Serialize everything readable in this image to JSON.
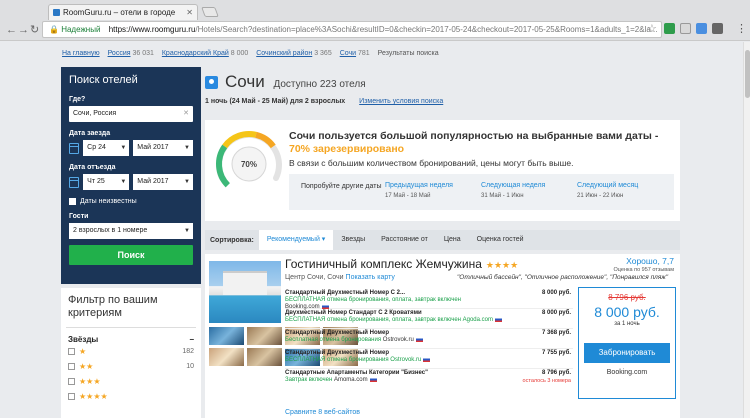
{
  "browser": {
    "tab_title": "RoomGuru.ru – отели в городе",
    "secure_label": "Надежный",
    "url_host": "https://www.roomguru.ru",
    "url_path": "/Hotels/Search?destination=place%3ASochi&resultID=0&checkin=2017-05-24&checkout=2017-05-25&Rooms=1&adults_1=2&la..."
  },
  "breadcrumbs": [
    {
      "label": "На главную",
      "count": ""
    },
    {
      "label": "Россия",
      "count": "36 031"
    },
    {
      "label": "Краснодарский Край",
      "count": "8 000"
    },
    {
      "label": "Сочинский район",
      "count": "3 365"
    },
    {
      "label": "Сочи",
      "count": "781"
    },
    {
      "label": "Результаты поиска",
      "count": ""
    }
  ],
  "search": {
    "title": "Поиск отелей",
    "where_label": "Где?",
    "where_value": "Сочи, Россия",
    "checkin_label": "Дата заезда",
    "checkin_day": "Ср 24",
    "checkin_month": "Май 2017",
    "checkout_label": "Дата отъезда",
    "checkout_day": "Чт 25",
    "checkout_month": "Май 2017",
    "unknown_dates": "Даты неизвестны",
    "guests_label": "Гости",
    "guests_value": "2 взрослых в 1 номере",
    "button": "Поиск"
  },
  "filter": {
    "title": "Фильтр по вашим критериям",
    "stars_label": "Звёзды",
    "rows": [
      {
        "stars": "★",
        "count": "182"
      },
      {
        "stars": "★★",
        "count": "10"
      },
      {
        "stars": "★★★",
        "count": ""
      },
      {
        "stars": "★★★★",
        "count": ""
      }
    ]
  },
  "header": {
    "city": "Сочи",
    "available": "Доступно 223 отеля",
    "nights": "1 ночь (24 Май - 25 Май) для 2 взрослых",
    "change_link": "Изменить условия поиска"
  },
  "popularity": {
    "gauge_percent": 70,
    "gauge_label": "70%",
    "main_text": "Сочи пользуется большой популярностью на выбранные вами даты -",
    "highlight": "70% зарезервировано",
    "note": "В связи с большим количеством бронирований, цены могут быть выше.",
    "alt_label": "Попробуйте другие даты",
    "alternatives": [
      {
        "link": "Предыдущая неделя",
        "dates": "17 Май - 18 Май"
      },
      {
        "link": "Следующая неделя",
        "dates": "31 Май - 1 Июн"
      },
      {
        "link": "Следующий месяц",
        "dates": "21 Июн - 22 Июн"
      }
    ],
    "colors": {
      "green": "#3cb878",
      "yellow": "#f5c518",
      "orange": "#f5a623",
      "grey": "#e3e3e3"
    }
  },
  "sort": {
    "label": "Сортировка:",
    "tabs": [
      "Рекомендуемый ▾",
      "Звезды",
      "Расстояние от",
      "Цена",
      "Оценка гостей"
    ]
  },
  "hotel": {
    "name": "Гостиничный комплекс Жемчужина",
    "stars": "★★★★",
    "location": "Центр Сочи, Сочи",
    "map_link": "Показать карту",
    "rating": "Хорошо, 7,7",
    "rating_sub": "Оценка по 957 отзывам",
    "quote": "\"Отличный бассейн\", \"Отличное расположение\", \"Понравился пляж\"",
    "offers": [
      {
        "name": "Стандартный Двухместный Номер С 2...",
        "note": "БЕСПЛАТНАЯ отмена бронирования, оплата, завтрак включен",
        "source": "Booking.com",
        "price": "8 000 руб.",
        "remaining": ""
      },
      {
        "name": "Двухместный Номер Стандарт С 2 Кроватями",
        "note": "БЕСПЛАТНАЯ отмена бронирования, оплата, завтрак включен Agoda.com",
        "source": "",
        "price": "8 000 руб.",
        "remaining": ""
      },
      {
        "name": "Стандартный Двухместный Номер",
        "note": "Бесплатная отмена бронирования",
        "source": "Ostrovok.ru",
        "price": "7 368 руб.",
        "remaining": ""
      },
      {
        "name": "Стандартный Двухместный Номер",
        "note": "БЕСПЛАТНАЯ отмена бронирования Ostrovok.ru",
        "source": "",
        "price": "7 755 руб.",
        "remaining": ""
      },
      {
        "name": "Стандартные Апартаменты Категории \"Бизнес\"",
        "note": "Завтрак включен",
        "source": "Amoma.com",
        "price": "8 796 руб.",
        "remaining": "осталось 3 номера"
      }
    ],
    "more_link": "Сравните 8 веб-сайтов",
    "old_price": "8 796 руб.",
    "new_price": "8 000 руб.",
    "per_night": "за 1 ночь",
    "book_button": "Забронировать",
    "book_source": "Booking.com"
  }
}
